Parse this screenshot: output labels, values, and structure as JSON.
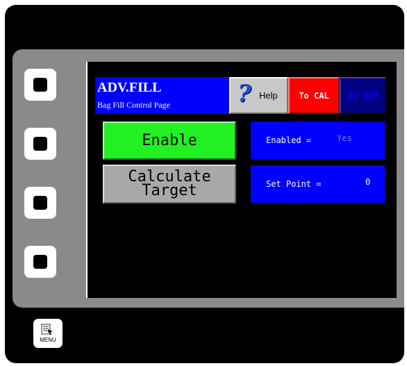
{
  "header": {
    "title": "ADV.FILL",
    "subtitle": "Bag Fill Control Page"
  },
  "toolbar": {
    "help_label": "Help",
    "help_icon": "question-mark-icon",
    "to_cal_label": "To CAL",
    "to_adm_label": "To ADM"
  },
  "buttons": {
    "enable_label": "Enable",
    "calculate_line1": "Calculate",
    "calculate_line2": "Target"
  },
  "status": {
    "enabled_label": "Enabled =",
    "enabled_value": "Yes",
    "setpoint_label": "Set Point =",
    "setpoint_value": "0"
  },
  "menu": {
    "label": "MENU",
    "icon": "menu-list-icon"
  },
  "colors": {
    "title_bg": "#0000ff",
    "enable_bg": "#22f022",
    "to_cal_bg": "#ff0000",
    "to_adm_bg": "#000080",
    "readout_bg": "#0000ff"
  }
}
